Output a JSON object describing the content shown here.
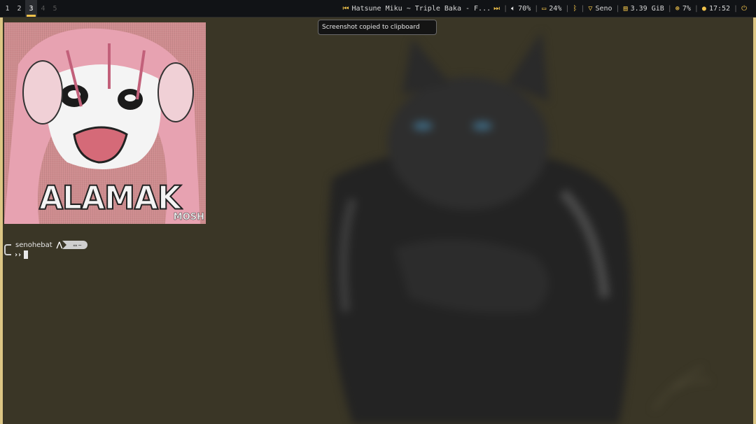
{
  "workspaces": [
    {
      "label": "1",
      "state": "occupied"
    },
    {
      "label": "2",
      "state": "occupied"
    },
    {
      "label": "3",
      "state": "active"
    },
    {
      "label": "4",
      "state": "empty"
    },
    {
      "label": "5",
      "state": "empty"
    }
  ],
  "status_bar": {
    "media_title": "Hatsune Miku ~ Triple Baka - F...",
    "volume": "70%",
    "battery": "24%",
    "wifi": "Seno",
    "memory": "3.39 GiB",
    "cpu": "7%",
    "clock": "17:52"
  },
  "notification": {
    "text": "Screenshot copied to clipboard"
  },
  "terminal": {
    "ascii_caption": "ALAMAK",
    "ascii_watermark": "MOSH",
    "prompt_user": "senohebat",
    "prompt_os_glyph": "⋀",
    "prompt_dir": "~",
    "prompt_symbol": "››"
  },
  "colors": {
    "accent": "#f0c24a",
    "bar_bg": "#111316",
    "wallpaper_bg": "#3a3626",
    "frame": "#dcc684"
  }
}
